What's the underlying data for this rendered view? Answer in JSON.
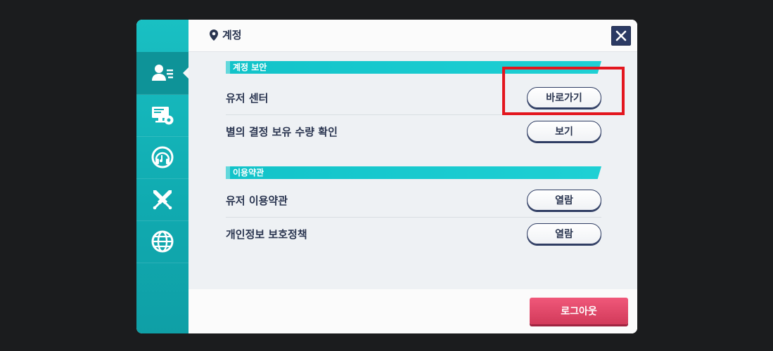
{
  "header": {
    "title": "계정",
    "title_icon": "location-pin-icon",
    "close_icon": "close-icon"
  },
  "sidebar": {
    "items": [
      {
        "name": "account",
        "icon": "account-icon",
        "active": true
      },
      {
        "name": "system",
        "icon": "monitor-gear-icon",
        "active": false
      },
      {
        "name": "sound",
        "icon": "headphones-icon",
        "active": false
      },
      {
        "name": "battle",
        "icon": "crossed-swords-icon",
        "active": false
      },
      {
        "name": "language",
        "icon": "globe-icon",
        "active": false
      }
    ]
  },
  "sections": [
    {
      "title": "계정 보안",
      "rows": [
        {
          "label": "유저 센터",
          "button": "바로가기"
        },
        {
          "label": "별의 결정 보유 수량 확인",
          "button": "보기"
        }
      ]
    },
    {
      "title": "이용약관",
      "rows": [
        {
          "label": "유저 이용약관",
          "button": "열람"
        },
        {
          "label": "개인정보 보호정책",
          "button": "열람"
        }
      ]
    }
  ],
  "footer": {
    "logout_label": "로그아웃"
  },
  "colors": {
    "accent": "#19c0c3",
    "navy": "#2a3550",
    "logout": "#e04a6a",
    "highlight": "#e3161e"
  }
}
